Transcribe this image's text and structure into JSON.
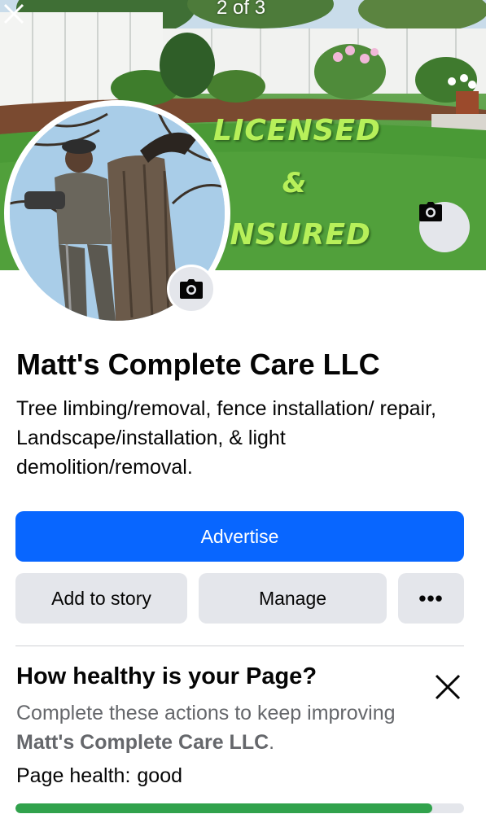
{
  "cover": {
    "counter": "2 of 3",
    "text_line1": "LICENSED",
    "text_line2": "&",
    "text_line3": "INSURED"
  },
  "page": {
    "name": "Matt's Complete Care LLC",
    "description": "Tree limbing/removal, fence installation/ repair, Landscape/installation, & light demolition/removal."
  },
  "actions": {
    "advertise_label": "Advertise",
    "add_to_story_label": "Add to story",
    "manage_label": "Manage",
    "more_label": "•••"
  },
  "page_health": {
    "title": "How healthy is your Page?",
    "subtitle_prefix": "Complete these actions to keep improving ",
    "subtitle_page_name": "Matt's Complete Care LLC",
    "subtitle_suffix": ".",
    "status_label": "Page health:",
    "status_value": "good",
    "progress": 0.93
  },
  "colors": {
    "primary_button": "#0866ff",
    "secondary_button": "#e4e6eb",
    "health_bar": "#31a24c",
    "cover_text": "#b7f05a"
  },
  "icons": {
    "close": "close-icon",
    "camera": "camera-icon",
    "more": "more-dots-icon"
  }
}
